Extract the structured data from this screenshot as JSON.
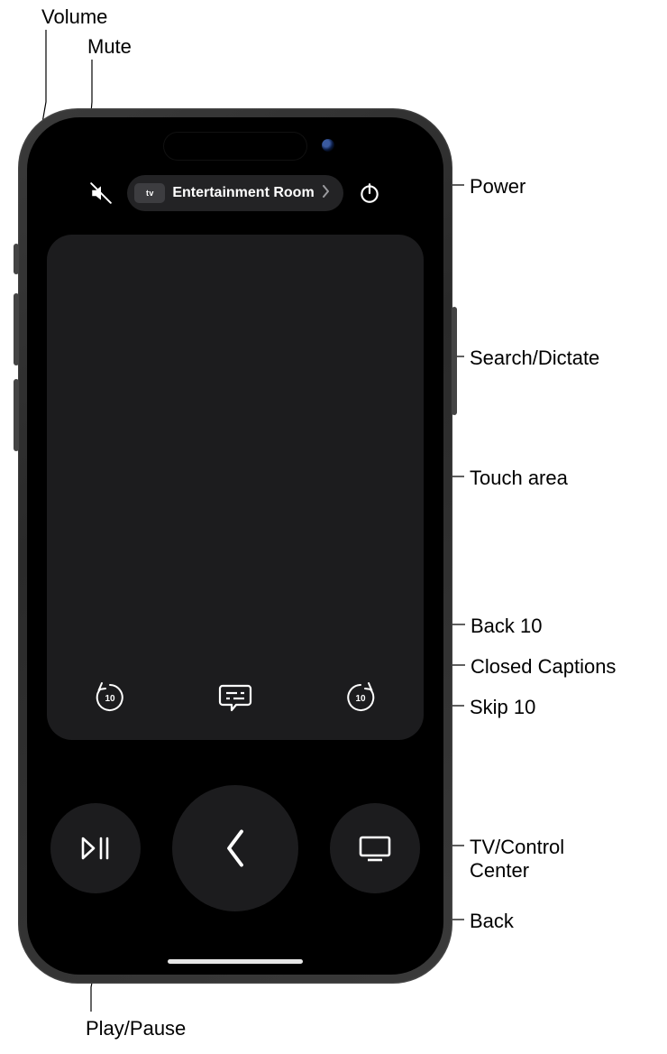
{
  "callouts": {
    "volume": "Volume",
    "mute": "Mute",
    "power": "Power",
    "search_dictate": "Search/Dictate",
    "touch_area": "Touch area",
    "back10": "Back 10",
    "closed_captions": "Closed Captions",
    "skip10": "Skip 10",
    "tv_control_center": "TV/Control\nCenter",
    "back": "Back",
    "play_pause": "Play/Pause"
  },
  "remote": {
    "atv_badge": "tv",
    "device_name": "Entertainment Room"
  }
}
